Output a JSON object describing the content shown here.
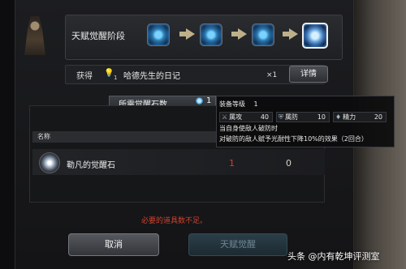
{
  "stage": {
    "title": "天赋觉醒阶段"
  },
  "acquire": {
    "label": "获得",
    "bulb_icon": "bulb-icon",
    "bulb_count": "1",
    "item_name": "哈德先生的日记",
    "quantity": "×1",
    "detail_button": "详情"
  },
  "required": {
    "title": "所需觉醒石数",
    "count": "1"
  },
  "table": {
    "header_name": "名称"
  },
  "item": {
    "name": "勒凡的觉醒石",
    "owned": "1",
    "required": "0"
  },
  "warning": "必要的道具数不足。",
  "buttons": {
    "cancel": "取消",
    "awaken": "天赋觉醒"
  },
  "tooltip": {
    "level_label": "装备等级",
    "level_value": "1",
    "stats": [
      {
        "icon": "sword-icon",
        "label": "属攻",
        "value": "40"
      },
      {
        "icon": "shield-icon",
        "label": "属防",
        "value": "10"
      },
      {
        "icon": "drop-icon",
        "label": "精力",
        "value": "20"
      }
    ],
    "line1": "当自身使敌人破防时",
    "line2": "对破防的敌人赋予光耐性下降10%的效果（2回合）"
  },
  "watermark": "头条 @内有乾坤评测室",
  "colors": {
    "warning": "#d0412d",
    "owned_insufficient": "#c8452c",
    "gem_blue": "#2f7fb6"
  }
}
